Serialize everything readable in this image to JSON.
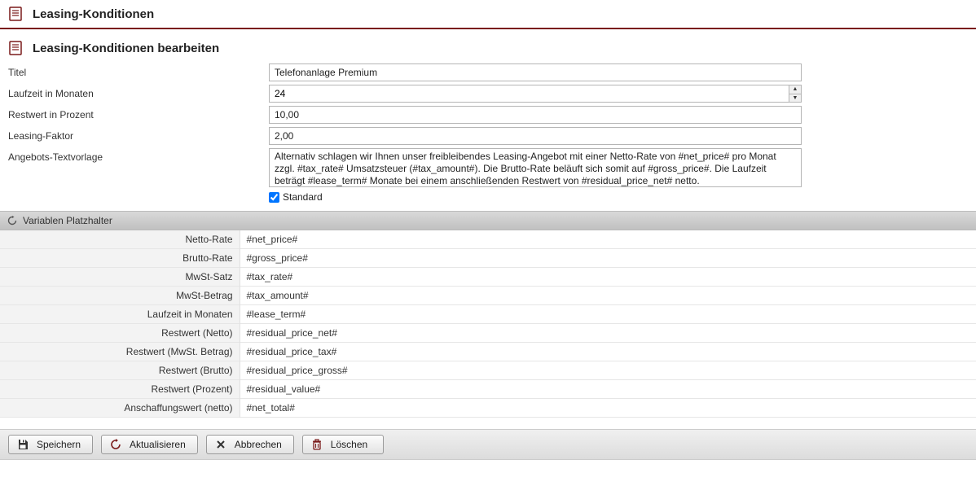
{
  "header": {
    "title": "Leasing-Konditionen",
    "sub_title": "Leasing-Konditionen bearbeiten"
  },
  "form": {
    "titel_label": "Titel",
    "titel_value": "Telefonanlage Premium",
    "laufzeit_label": "Laufzeit in Monaten",
    "laufzeit_value": "24",
    "restwert_label": "Restwert in Prozent",
    "restwert_value": "10,00",
    "faktor_label": "Leasing-Faktor",
    "faktor_value": "2,00",
    "textvorlage_label": "Angebots-Textvorlage",
    "textvorlage_value": "Alternativ schlagen wir Ihnen unser freibleibendes Leasing-Angebot mit einer Netto-Rate von #net_price# pro Monat zzgl. #tax_rate# Umsatzsteuer (#tax_amount#). Die Brutto-Rate beläuft sich somit auf #gross_price#. Die Laufzeit beträgt #lease_term# Monate bei einem anschließenden Restwert von #residual_price_net# netto.",
    "standard_label": "Standard",
    "standard_checked": true
  },
  "section": {
    "title": "Variablen Platzhalter"
  },
  "variables": [
    {
      "label": "Netto-Rate",
      "value": "#net_price#"
    },
    {
      "label": "Brutto-Rate",
      "value": "#gross_price#"
    },
    {
      "label": "MwSt-Satz",
      "value": "#tax_rate#"
    },
    {
      "label": "MwSt-Betrag",
      "value": "#tax_amount#"
    },
    {
      "label": "Laufzeit in Monaten",
      "value": "#lease_term#"
    },
    {
      "label": "Restwert (Netto)",
      "value": "#residual_price_net#"
    },
    {
      "label": "Restwert (MwSt. Betrag)",
      "value": "#residual_price_tax#"
    },
    {
      "label": "Restwert (Brutto)",
      "value": "#residual_price_gross#"
    },
    {
      "label": "Restwert (Prozent)",
      "value": "#residual_value#"
    },
    {
      "label": "Anschaffungswert (netto)",
      "value": "#net_total#"
    }
  ],
  "buttons": {
    "save": "Speichern",
    "refresh": "Aktualisieren",
    "cancel": "Abbrechen",
    "delete": "Löschen"
  },
  "colors": {
    "accent": "#7a1a1a"
  }
}
